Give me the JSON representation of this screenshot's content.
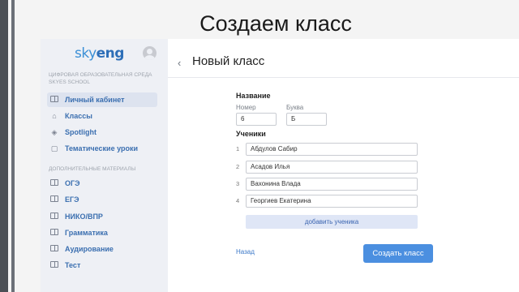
{
  "slide": {
    "title": "Создаем класс"
  },
  "app": {
    "logo_sky": "sky",
    "logo_eng": "eng"
  },
  "sidebar": {
    "section1": "ЦИФРОВАЯ ОБРАЗОВАТЕЛЬНАЯ СРЕДА SKYES SCHOOL",
    "section2": "ДОПОЛНИТЕЛЬНЫЕ МАТЕРИАЛЫ",
    "items": [
      {
        "label": "Личный кабинет",
        "icon": "book-icon"
      },
      {
        "label": "Классы",
        "icon": "home-icon"
      },
      {
        "label": "Spotlight",
        "icon": "graduation-cap-icon"
      },
      {
        "label": "Тематические уроки",
        "icon": "clipboard-icon"
      },
      {
        "label": "ОГЭ",
        "icon": "book-icon"
      },
      {
        "label": "ЕГЭ",
        "icon": "book-icon"
      },
      {
        "label": "НИКО/ВПР",
        "icon": "book-icon"
      },
      {
        "label": "Грамматика",
        "icon": "book-icon"
      },
      {
        "label": "Аудирование",
        "icon": "book-icon"
      },
      {
        "label": "Тест",
        "icon": "book-icon"
      }
    ]
  },
  "main": {
    "back_icon": "‹",
    "title": "Новый класс",
    "name_label": "Название",
    "number_label": "Номер",
    "number_value": "6",
    "letter_label": "Буква",
    "letter_value": "Б",
    "students_label": "Ученики",
    "students": [
      {
        "num": "1",
        "name": "Абдулов Сабир"
      },
      {
        "num": "2",
        "name": "Асадов Илья"
      },
      {
        "num": "3",
        "name": "Вахонина Влада"
      },
      {
        "num": "4",
        "name": "Георгиев Екатерина"
      }
    ],
    "add_student": "добавить ученика",
    "back_link": "Назад",
    "create_button": "Создать класс"
  }
}
